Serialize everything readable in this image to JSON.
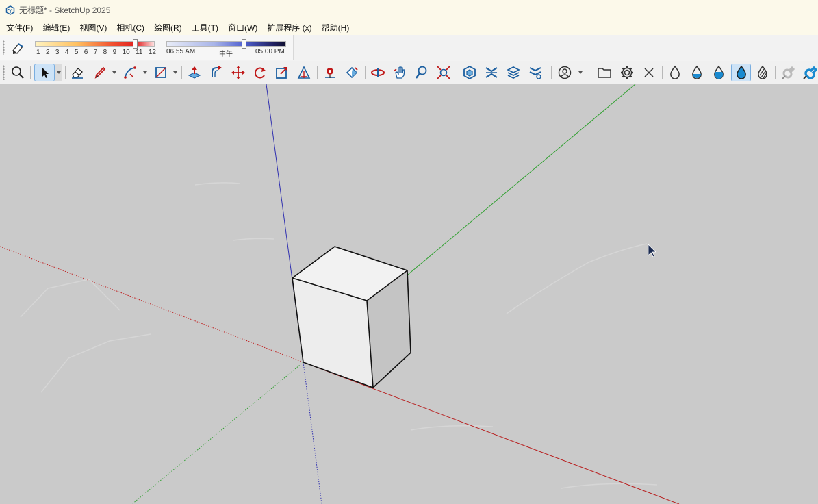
{
  "window": {
    "title": "无标题* - SketchUp 2025"
  },
  "menu": [
    "文件(F)",
    "编辑(E)",
    "视图(V)",
    "相机(C)",
    "绘图(R)",
    "工具(T)",
    "窗口(W)",
    "扩展程序 (x)",
    "帮助(H)"
  ],
  "shadow": {
    "month_ticks": [
      "1",
      "2",
      "3",
      "4",
      "5",
      "6",
      "7",
      "8",
      "9",
      "10",
      "11",
      "12"
    ],
    "month_value": 11,
    "time_start": "06:55 AM",
    "time_mid": "中午",
    "time_end": "05:00 PM"
  },
  "toolbar": {
    "tools": [
      "zoom-icon",
      "select-arrow-icon",
      "eraser-icon",
      "pencil-icon",
      "arc-icon",
      "rectangle-icon",
      "push-pull-icon",
      "follow-me-icon",
      "move-icon",
      "rotate-icon",
      "scale-icon",
      "offset-icon",
      "tape-measure-icon",
      "paint-bucket-icon",
      "orbit-icon",
      "pan-icon",
      "zoom-small-icon",
      "zoom-extents-icon",
      "solid-tools-icon",
      "intersect-icon",
      "layers-icon",
      "outliner-icon",
      "account-icon",
      "folder-icon",
      "settings-icon",
      "close-icon",
      "xray-drop-icon",
      "drop-half-icon",
      "drop-fill-icon",
      "drop-selected-icon",
      "drop-hatched-icon",
      "magnet-off-icon",
      "magnet-icon"
    ],
    "accent": "#1c5fa0"
  },
  "viewport": {
    "axis_colors": {
      "red": "#c02020",
      "green": "#30a030",
      "blue": "#3030b0"
    },
    "background": "#cacaca"
  }
}
